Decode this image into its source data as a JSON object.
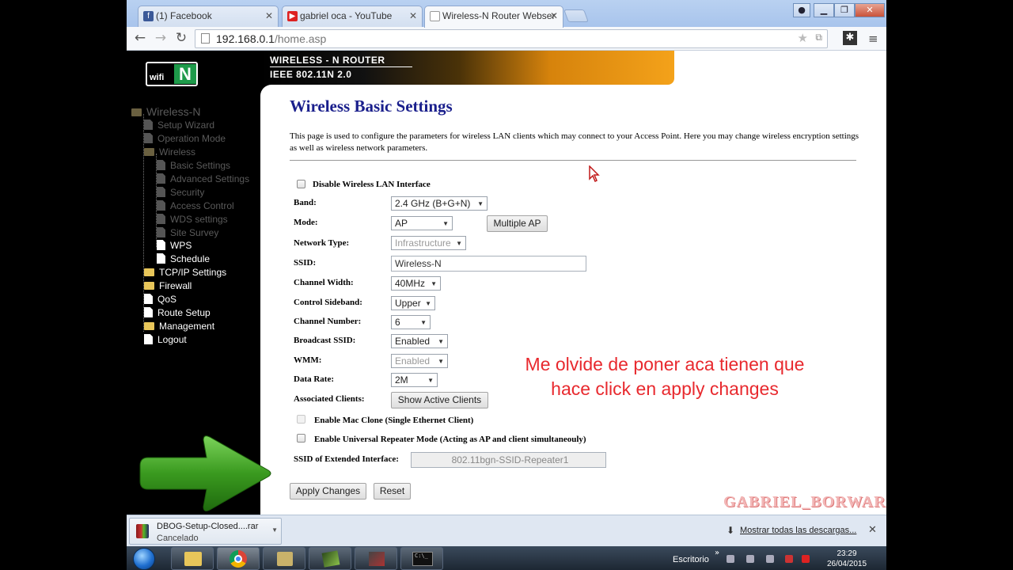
{
  "browser": {
    "tabs": [
      {
        "label": "(1) Facebook",
        "icon": "facebook-icon"
      },
      {
        "label": "gabriel oca - YouTube",
        "icon": "youtube-icon"
      },
      {
        "label": "Wireless-N Router Webser",
        "icon": "page-icon",
        "active": true
      }
    ],
    "address": {
      "host": "192.168.0.1",
      "path": "/home.asp"
    }
  },
  "router": {
    "logo": {
      "wifi": "wifi",
      "n": "N"
    },
    "banner": {
      "line1": "WIRELESS - N ROUTER",
      "line2": "IEEE 802.11N 2.0"
    },
    "menu": [
      {
        "label": "Wireless-N",
        "type": "root",
        "dim": true
      },
      {
        "label": "Setup Wizard",
        "type": "file",
        "dim": true
      },
      {
        "label": "Operation Mode",
        "type": "file",
        "dim": true
      },
      {
        "label": "Wireless",
        "type": "folder",
        "dim": true
      },
      {
        "label": "Basic Settings",
        "type": "file",
        "dim": true
      },
      {
        "label": "Advanced Settings",
        "type": "file",
        "dim": true
      },
      {
        "label": "Security",
        "type": "file",
        "dim": true
      },
      {
        "label": "Access Control",
        "type": "file",
        "dim": true
      },
      {
        "label": "WDS settings",
        "type": "file",
        "dim": true
      },
      {
        "label": "Site Survey",
        "type": "file",
        "dim": true
      },
      {
        "label": "WPS",
        "type": "file",
        "dim": false
      },
      {
        "label": "Schedule",
        "type": "file",
        "dim": false
      },
      {
        "label": "TCP/IP Settings",
        "type": "folder",
        "dim": false
      },
      {
        "label": "Firewall",
        "type": "folder",
        "dim": false
      },
      {
        "label": "QoS",
        "type": "file",
        "dim": false
      },
      {
        "label": "Route Setup",
        "type": "file",
        "dim": false
      },
      {
        "label": "Management",
        "type": "folder",
        "dim": false
      },
      {
        "label": "Logout",
        "type": "file",
        "dim": false
      }
    ]
  },
  "form": {
    "title": "Wireless Basic Settings",
    "description": "This page is used to configure the parameters for wireless LAN clients which may connect to your Access Point. Here you may change wireless encryption settings as well as wireless network parameters.",
    "disable_wlan_label": "Disable Wireless LAN Interface",
    "band": {
      "label": "Band:",
      "value": "2.4 GHz (B+G+N)"
    },
    "mode": {
      "label": "Mode:",
      "value": "AP",
      "multiple_ap": "Multiple AP"
    },
    "network_type": {
      "label": "Network Type:",
      "value": "Infrastructure"
    },
    "ssid": {
      "label": "SSID:",
      "value": "Wireless-N"
    },
    "channel_width": {
      "label": "Channel Width:",
      "value": "40MHz"
    },
    "control_sideband": {
      "label": "Control Sideband:",
      "value": "Upper"
    },
    "channel_number": {
      "label": "Channel Number:",
      "value": "6"
    },
    "broadcast_ssid": {
      "label": "Broadcast SSID:",
      "value": "Enabled"
    },
    "wmm": {
      "label": "WMM:",
      "value": "Enabled"
    },
    "data_rate": {
      "label": "Data Rate:",
      "value": "2M"
    },
    "associated_clients": {
      "label": "Associated Clients:",
      "button": "Show Active Clients"
    },
    "mac_clone_label": "Enable Mac Clone (Single Ethernet Client)",
    "repeater_label": "Enable Universal Repeater Mode (Acting as AP and client simultaneouly)",
    "extended_ssid": {
      "label": "SSID of Extended Interface:",
      "value": "802.11bgn-SSID-Repeater1"
    },
    "apply": "Apply Changes",
    "reset": "Reset"
  },
  "overlay": {
    "note_line1": "Me olvide de poner aca tienen que",
    "note_line2": "hace click en apply changes",
    "watermark": "GABRIEL_BORWARD"
  },
  "downloads": {
    "item_name": "DBOG-Setup-Closed....rar",
    "item_status": "Cancelado",
    "show_all": "Mostrar todas las descargas..."
  },
  "taskbar": {
    "desktop_label": "Escritorio",
    "time": "23:29",
    "date": "26/04/2015"
  },
  "colors": {
    "title": "#1a1f8c",
    "note": "#e8292e",
    "logo_green": "#1e9a4a",
    "banner_orange": "#f4a21a"
  }
}
